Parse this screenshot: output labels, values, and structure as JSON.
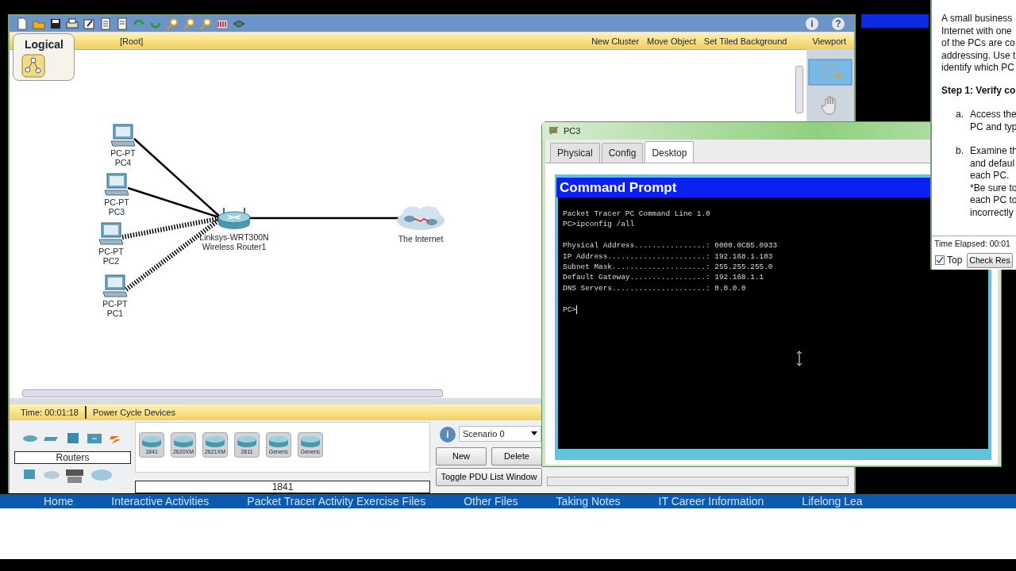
{
  "help_buttons": [
    "i",
    "?"
  ],
  "workspace": {
    "tab": "Logical",
    "path": "[Root]",
    "actions": [
      "New Cluster",
      "Move Object",
      "Set Tiled Background",
      "Viewport"
    ]
  },
  "topology": {
    "nodes": [
      {
        "kind": "pc",
        "type": "PC-PT",
        "name": "PC4",
        "link": {
          "kind": "wired"
        }
      },
      {
        "kind": "pc",
        "type": "PC-PT",
        "name": "PC3",
        "link": {
          "kind": "wired"
        }
      },
      {
        "kind": "pc",
        "type": "PC-PT",
        "name": "PC2",
        "link": {
          "kind": "wireless"
        }
      },
      {
        "kind": "pc",
        "type": "PC-PT",
        "name": "PC1",
        "link": {
          "kind": "wireless"
        }
      },
      {
        "kind": "router",
        "type": "Linksys-WRT300N",
        "name": "Wireless Router1",
        "link": {
          "kind": "wired"
        }
      },
      {
        "kind": "cloud",
        "name": "The Internet"
      }
    ]
  },
  "status_bar": {
    "time": "Time: 00:01:18",
    "button": "Power Cycle Devices"
  },
  "device_panel": {
    "category": "Routers",
    "models": [
      "1841",
      "2620XM",
      "2621XM",
      "2811",
      "Generic",
      "Generic"
    ],
    "selected_model": "1841"
  },
  "scenario": {
    "info": "i",
    "name": "Scenario 0",
    "buttons": [
      "New",
      "Delete"
    ],
    "toggle": "Toggle PDU List Window"
  },
  "pc_window": {
    "title": "PC3",
    "tabs": [
      {
        "label": "Physical",
        "selected": false
      },
      {
        "label": "Config",
        "selected": false
      },
      {
        "label": "Desktop",
        "selected": true
      }
    ],
    "app_title": "Command Prompt",
    "blocks": [
      [
        "Packet Tracer PC Command Line 1.0",
        "PC>ipconfig /all"
      ],
      [
        "Physical Address................: 0000.0CB5.0933",
        "IP Address......................: 192.168.1.103",
        "Subnet Mask.....................: 255.255.255.0",
        "Default Gateway.................: 192.168.1.1",
        "DNS Servers.....................: 0.0.0.0"
      ],
      [
        "PC>"
      ]
    ]
  },
  "instructions": {
    "intro": [
      "A small business",
      "Internet with one",
      "of the PCs are co",
      "addressing. Use t",
      "identify which PC"
    ],
    "step": "Step 1: Verify co",
    "items": [
      {
        "marker": "a.",
        "lines": [
          "Access the",
          "PC and typ"
        ]
      },
      {
        "marker": "b.",
        "lines": [
          "Examine th",
          "and defaul",
          "each PC.",
          "*Be sure to",
          "each PC to",
          "incorrectly"
        ]
      }
    ],
    "time_elapsed": "Time Elapsed: 00:01",
    "top": {
      "label": "Top",
      "checked": true
    },
    "button": "Check Res"
  },
  "bottom_nav": [
    "Home",
    "Interactive Activities",
    "Packet Tracer Activity Exercise Files",
    "Other Files",
    "Taking Notes",
    "IT Career Information",
    "Lifelong Lea"
  ]
}
